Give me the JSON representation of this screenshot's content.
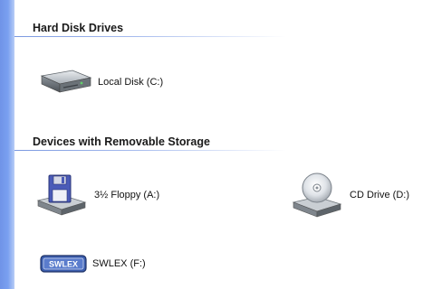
{
  "groups": [
    {
      "title": "Hard Disk Drives",
      "items": [
        {
          "label": "Local Disk (C:)",
          "icon": "hard-disk-icon"
        }
      ]
    },
    {
      "title": "Devices with Removable Storage",
      "items": [
        {
          "label": "3½ Floppy (A:)",
          "icon": "floppy-drive-icon"
        },
        {
          "label": "CD Drive (D:)",
          "icon": "cd-drive-icon"
        },
        {
          "label": "SWLEX (F:)",
          "icon": "usb-drive-icon"
        }
      ]
    }
  ],
  "usb_icon_text": "SWLEX",
  "colors": {
    "stripe": "#7aa0f0",
    "rule": "#7a98e0",
    "floppy": "#4b5bb8",
    "usb": "#3c5fb0"
  }
}
